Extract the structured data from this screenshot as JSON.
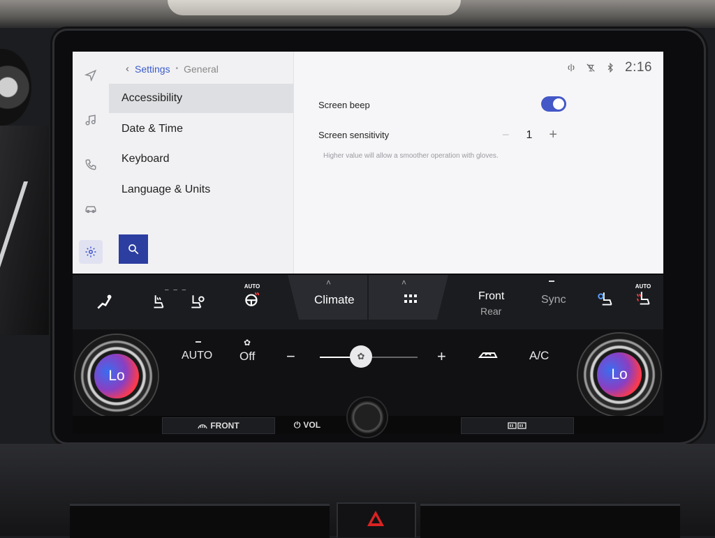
{
  "breadcrumb": {
    "back_glyph": "‹",
    "parent": "Settings",
    "separator": "•",
    "current": "General"
  },
  "sidebar_rail": {
    "icons": [
      "navigation-icon",
      "music-icon",
      "phone-icon",
      "car-icon",
      "gear-icon"
    ],
    "active": "gear-icon"
  },
  "settings_list": {
    "items": [
      {
        "label": "Accessibility",
        "active": true
      },
      {
        "label": "Date & Time",
        "active": false
      },
      {
        "label": "Keyboard",
        "active": false
      },
      {
        "label": "Language & Units",
        "active": false
      }
    ]
  },
  "status_bar": {
    "time": "2:16",
    "icons": [
      "wireless-charging-icon",
      "voice-muted-icon",
      "bluetooth-icon"
    ]
  },
  "detail": {
    "screen_beep_label": "Screen beep",
    "screen_beep_on": true,
    "screen_sensitivity_label": "Screen sensitivity",
    "minus_glyph": "−",
    "sensitivity_value": "1",
    "plus_glyph": "+",
    "hint": "Higher value will allow a smoother operation with gloves."
  },
  "climate_bar": {
    "driver_seat_dashes": "– – –",
    "steering_auto_tag": "AUTO",
    "climate_label": "Climate",
    "caret_glyph": "˄",
    "front_label": "Front",
    "rear_label": "Rear",
    "sync_label": "Sync",
    "passenger_auto_tag": "AUTO"
  },
  "controls": {
    "left_temp": "Lo",
    "right_temp": "Lo",
    "auto_label": "AUTO",
    "fan_off_label": "Off",
    "fan_minus": "−",
    "fan_plus": "+",
    "fan_level": 0.43,
    "ac_label": "A/C"
  },
  "hard_buttons": {
    "front_defrost": "FRONT",
    "vol": "VOL"
  },
  "colors": {
    "accent": "#3b5bc9",
    "search_button": "#2c3ea0",
    "toggle_on": "#4458c7",
    "hazard": "#dd2222"
  }
}
